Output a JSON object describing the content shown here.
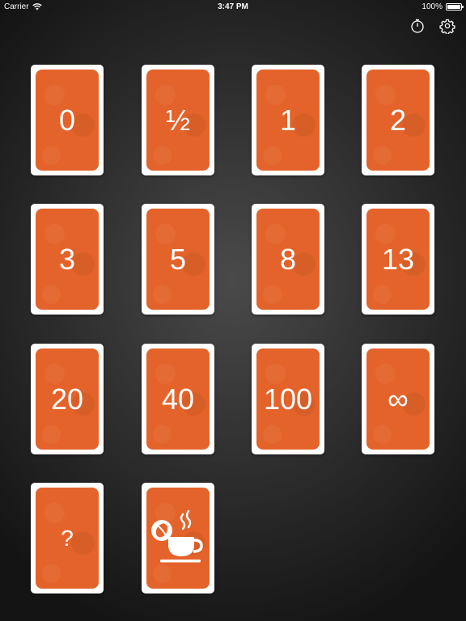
{
  "status_bar": {
    "carrier": "Carrier",
    "time": "3:47 PM",
    "battery_text": "100%",
    "battery_level": 1.0
  },
  "toolbar": {
    "timer_icon": "stopwatch-icon",
    "settings_icon": "gear-icon"
  },
  "colors": {
    "card_border": "#ffffff",
    "card_face": "#e4632a",
    "background": "#2c2c2c"
  },
  "cards": [
    {
      "label": "0"
    },
    {
      "label": "½"
    },
    {
      "label": "1"
    },
    {
      "label": "2"
    },
    {
      "label": "3"
    },
    {
      "label": "5"
    },
    {
      "label": "8"
    },
    {
      "label": "13"
    },
    {
      "label": "20"
    },
    {
      "label": "40"
    },
    {
      "label": "100"
    },
    {
      "label": "∞"
    },
    {
      "label": "?"
    },
    {
      "label": "",
      "icon": "coffee-break-icon"
    }
  ]
}
